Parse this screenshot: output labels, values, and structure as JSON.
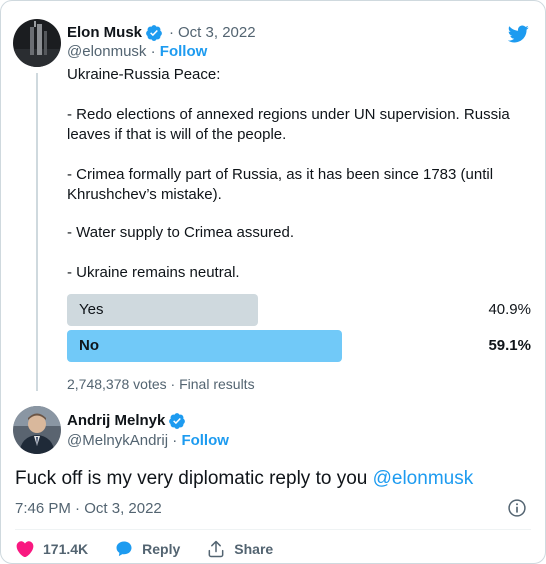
{
  "quoted_tweet": {
    "author_name": "Elon Musk",
    "date_separator": "·",
    "date": "Oct 3, 2022",
    "handle": "@elonmusk",
    "handle_separator": "·",
    "follow_label": "Follow",
    "body_paragraphs": [
      "Ukraine-Russia Peace:",
      "- Redo elections of annexed regions under UN supervision. Russia leaves if that is will of the people.",
      "- Crimea formally part of Russia, as it has been since 1783 (until Khrushchev’s mistake).",
      "- Water supply to Crimea assured.",
      "- Ukraine remains neutral."
    ],
    "poll": {
      "options": [
        {
          "label": "Yes",
          "percent_text": "40.9%",
          "fraction": 0.409,
          "winner": false
        },
        {
          "label": "No",
          "percent_text": "59.1%",
          "fraction": 0.591,
          "winner": true
        }
      ],
      "votes": "2,748,378 votes",
      "meta_separator": "·",
      "status": "Final results"
    }
  },
  "reply_tweet": {
    "author_name": "Andrij Melnyk",
    "handle": "@MelnykAndrij",
    "handle_separator": "·",
    "follow_label": "Follow",
    "text": "Fuck off is my very diplomatic reply to you",
    "mention": "@elonmusk",
    "time": "7:46 PM",
    "time_separator": "·",
    "date": "Oct 3, 2022",
    "likes": "171.4K",
    "reply_label": "Reply",
    "share_label": "Share"
  },
  "colors": {
    "accent": "#1d9bf0",
    "poll_loser": "#cfd9de",
    "poll_winner": "#71c9f8",
    "like": "#f91880"
  },
  "icons": {
    "brand": "twitter-bird-icon",
    "verified": "verified-badge-icon",
    "info": "info-icon",
    "like": "heart-icon",
    "reply": "comment-bubble-icon",
    "share": "share-upload-icon"
  }
}
